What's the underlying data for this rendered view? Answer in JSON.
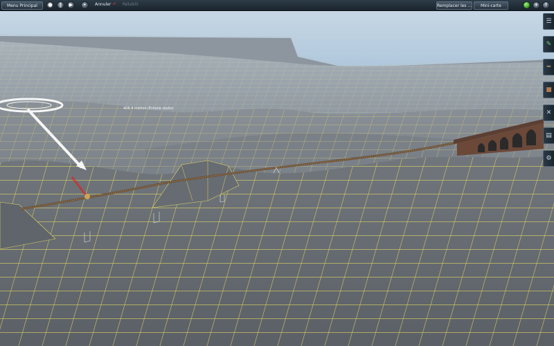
{
  "toolbar": {
    "menu_label": "Menu Principal",
    "undo_label": "Annuler",
    "redo_label": "Rétablir",
    "replace_label": "Remplacer les ...",
    "minimap_label": "Mini-carte"
  },
  "measurement": {
    "text": "408.4 mètres (Échelle réelle)"
  },
  "sidebar": {
    "tools": [
      "train-tool-icon",
      "paint-tool-icon",
      "track-tool-icon",
      "object-tool-icon",
      "wrench-tool-icon",
      "layers-tool-icon",
      "settings-tool-icon"
    ]
  },
  "colors": {
    "terrain": "#6d737a",
    "grid": "#e0d36a",
    "sky": "#a9c4db",
    "track": "#6a5038",
    "toolbar": "#1f2a33"
  }
}
